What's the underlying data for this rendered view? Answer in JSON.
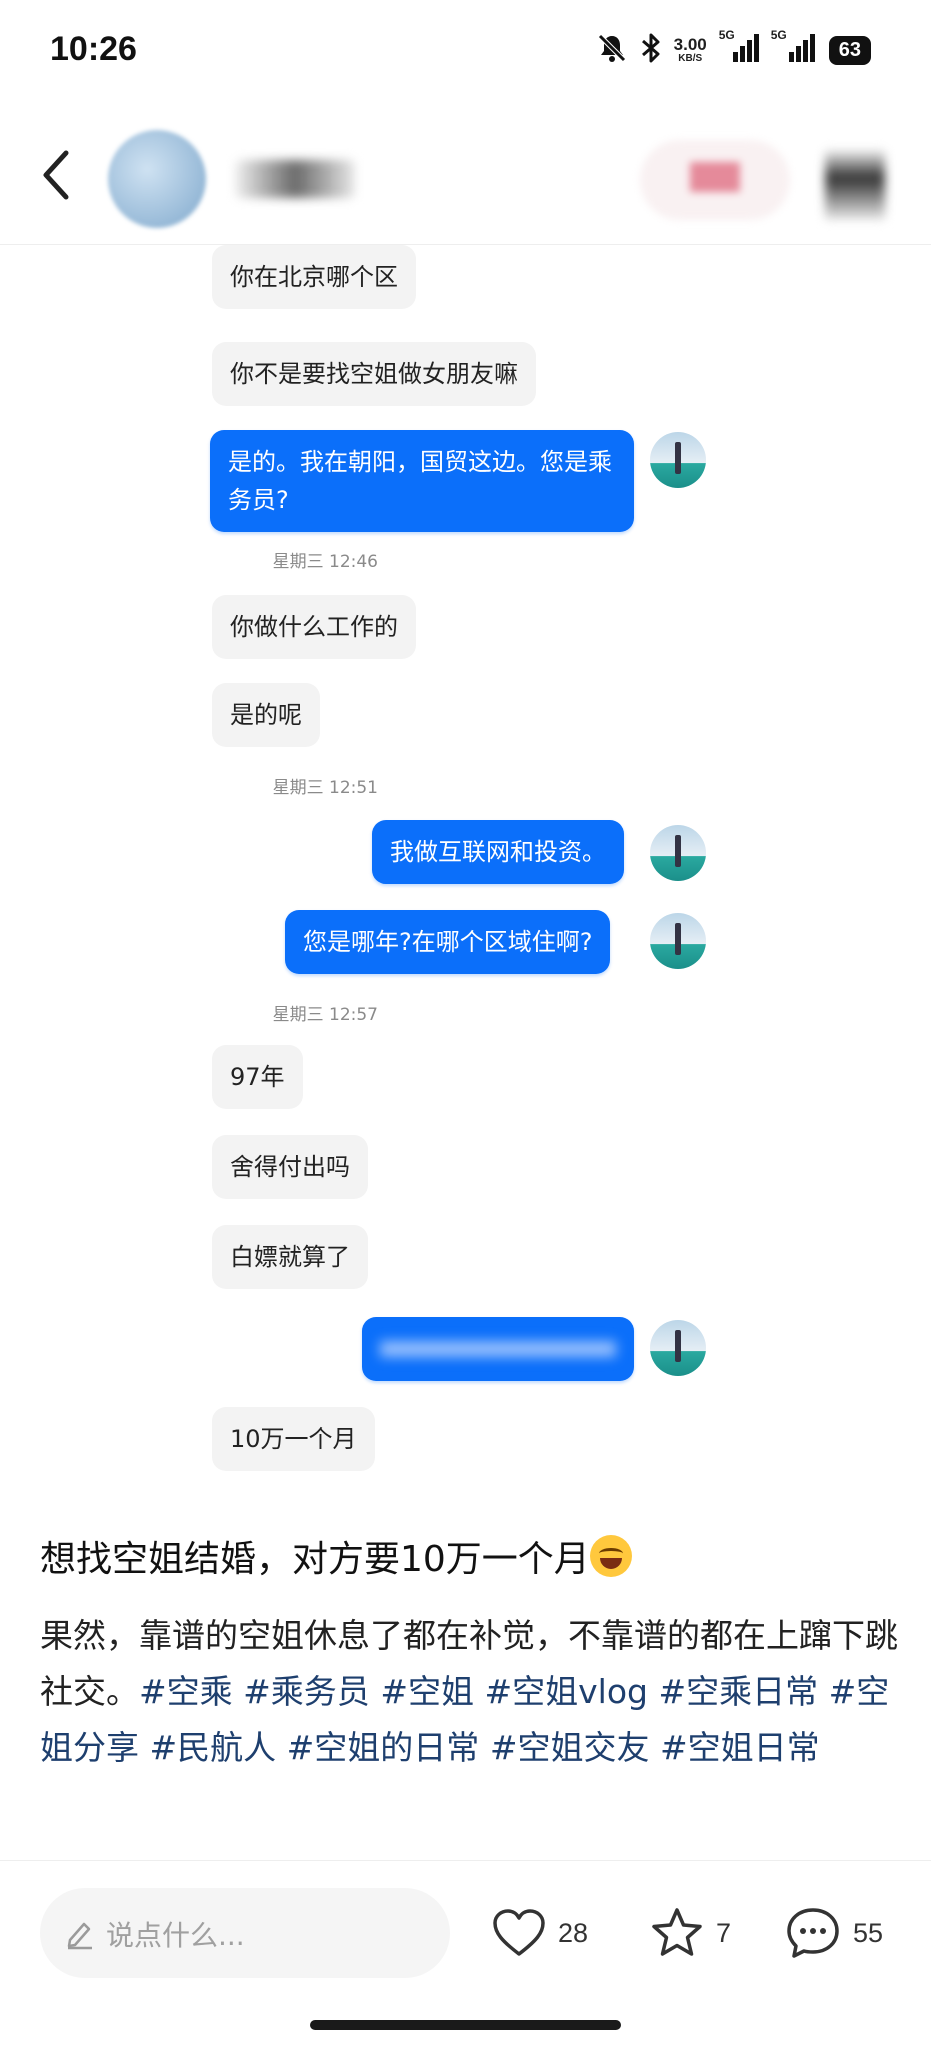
{
  "status_bar": {
    "time": "10:26",
    "speed_value": "3.00",
    "speed_unit": "KB/S",
    "signal1_label": "5G",
    "signal2_label": "5G",
    "battery": "63",
    "icons": [
      "bell-off-icon",
      "bluetooth-icon",
      "signal-icon",
      "signal-icon",
      "battery-icon"
    ]
  },
  "header": {
    "back_icon": "chevron-left-icon",
    "more_icon": "more-vertical-icon"
  },
  "messages": [
    {
      "side": "left",
      "text": "你在北京哪个区"
    },
    {
      "side": "left",
      "text": "你不是要找空姐做女朋友嘛"
    },
    {
      "side": "right",
      "text": "是的。我在朝阳，国贸这边。您是乘务员?"
    },
    {
      "side": "time",
      "text": "星期三 12:46"
    },
    {
      "side": "left",
      "text": "你做什么工作的"
    },
    {
      "side": "left",
      "text": "是的呢"
    },
    {
      "side": "time",
      "text": "星期三 12:51"
    },
    {
      "side": "right",
      "text": "我做互联网和投资。"
    },
    {
      "side": "right",
      "text": "您是哪年?在哪个区域住啊?"
    },
    {
      "side": "time",
      "text": "星期三 12:57"
    },
    {
      "side": "left",
      "text": "97年"
    },
    {
      "side": "left",
      "text": "舍得付出吗"
    },
    {
      "side": "left",
      "text": "白嫖就算了"
    },
    {
      "side": "right",
      "text": ""
    },
    {
      "side": "left",
      "text": "10万一个月"
    }
  ],
  "post": {
    "title": "想找空姐结婚，对方要10万一个月",
    "title_emoji": "face-with-tears-of-joy",
    "body_text": "果然，靠谱的空姐休息了都在补觉，不靠谱的都在上蹿下跳社交。",
    "tags": [
      "#空乘",
      "#乘务员",
      "#空姐",
      "#空姐vlog",
      "#空乘日常",
      "#空姐分享",
      "#民航人",
      "#空姐的日常",
      "#空姐交友",
      "#空姐日常"
    ]
  },
  "actions": {
    "comment_placeholder": "说点什么...",
    "likes": "28",
    "favorites": "7",
    "comments": "55"
  }
}
